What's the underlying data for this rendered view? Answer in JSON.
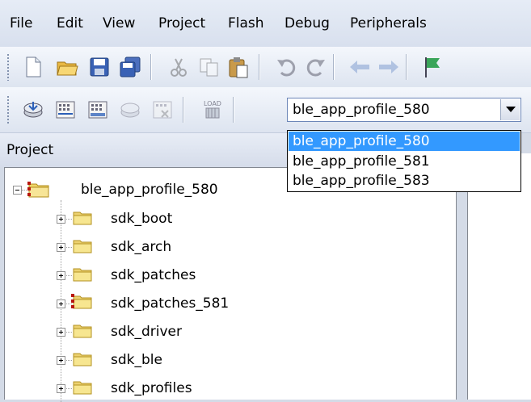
{
  "menu": {
    "items": [
      "File",
      "Edit",
      "View",
      "Project",
      "Flash",
      "Debug",
      "Peripherals"
    ]
  },
  "target_select": {
    "value": "ble_app_profile_580",
    "options": [
      "ble_app_profile_580",
      "ble_app_profile_581",
      "ble_app_profile_583"
    ],
    "selected_index": 0
  },
  "project_panel": {
    "title": "Project",
    "root": "ble_app_profile_580",
    "groups": [
      {
        "label": "sdk_boot",
        "icon": "folder-icon"
      },
      {
        "label": "sdk_arch",
        "icon": "folder-icon"
      },
      {
        "label": "sdk_patches",
        "icon": "folder-icon"
      },
      {
        "label": "sdk_patches_581",
        "icon": "folder-excluded-icon"
      },
      {
        "label": "sdk_driver",
        "icon": "folder-icon"
      },
      {
        "label": "sdk_ble",
        "icon": "folder-icon"
      },
      {
        "label": "sdk_profiles",
        "icon": "folder-icon"
      }
    ]
  },
  "colors": {
    "selection": "#3399ff",
    "folder": "#f5e58a"
  }
}
